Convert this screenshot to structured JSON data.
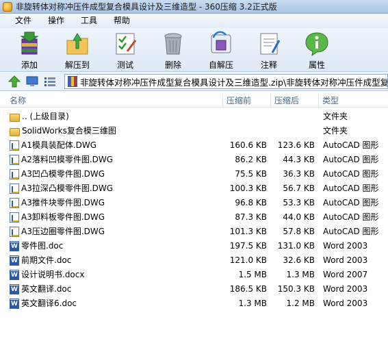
{
  "window": {
    "title": "非旋转体对称冲压件成型复合模具设计及三维造型 - 360压缩 3.2正式版"
  },
  "menu": [
    "文件",
    "操作",
    "工具",
    "帮助"
  ],
  "toolbar": [
    {
      "label": "添加",
      "icon": "add-archive-icon"
    },
    {
      "label": "解压到",
      "icon": "extract-to-icon"
    },
    {
      "label": "测试",
      "icon": "test-icon"
    },
    {
      "label": "删除",
      "icon": "delete-icon"
    },
    {
      "label": "自解压",
      "icon": "self-extract-icon"
    },
    {
      "label": "注释",
      "icon": "comment-icon"
    },
    {
      "label": "属性",
      "icon": "properties-icon"
    }
  ],
  "address": {
    "path": "非旋转体对称冲压件成型复合模具设计及三维造型.zip\\非旋转体对称冲压件成型复合模"
  },
  "columns": {
    "name": "名称",
    "size": "压缩前",
    "compressed": "压缩后",
    "type": "类型"
  },
  "files": [
    {
      "kind": "folder",
      "name": ".. (上级目录)",
      "size": "",
      "compressed": "",
      "type": "文件夹"
    },
    {
      "kind": "folder",
      "name": "SolidWorks复合模三维图",
      "size": "",
      "compressed": "",
      "type": "文件夹"
    },
    {
      "kind": "dwg",
      "name": "A1模具装配体.DWG",
      "size": "160.6 KB",
      "compressed": "123.6 KB",
      "type": "AutoCAD 图形"
    },
    {
      "kind": "dwg",
      "name": "A2落料凹模零件图.DWG",
      "size": "86.2 KB",
      "compressed": "44.3 KB",
      "type": "AutoCAD 图形"
    },
    {
      "kind": "dwg",
      "name": "A3凹凸模零件图.DWG",
      "size": "75.5 KB",
      "compressed": "36.3 KB",
      "type": "AutoCAD 图形"
    },
    {
      "kind": "dwg",
      "name": "A3拉深凸模零件图.DWG",
      "size": "100.3 KB",
      "compressed": "56.7 KB",
      "type": "AutoCAD 图形"
    },
    {
      "kind": "dwg",
      "name": "A3推件块零件图.DWG",
      "size": "96.8 KB",
      "compressed": "53.3 KB",
      "type": "AutoCAD 图形"
    },
    {
      "kind": "dwg",
      "name": "A3卸料板零件图.DWG",
      "size": "87.3 KB",
      "compressed": "44.0 KB",
      "type": "AutoCAD 图形"
    },
    {
      "kind": "dwg",
      "name": "A3压边圈零件图.DWG",
      "size": "101.3 KB",
      "compressed": "57.8 KB",
      "type": "AutoCAD 图形"
    },
    {
      "kind": "doc",
      "name": "零件图.doc",
      "size": "197.5 KB",
      "compressed": "131.0 KB",
      "type": "Word 2003"
    },
    {
      "kind": "doc",
      "name": "前期文件.doc",
      "size": "121.0 KB",
      "compressed": "32.6 KB",
      "type": "Word 2003"
    },
    {
      "kind": "doc",
      "name": "设计说明书.docx",
      "size": "1.5 MB",
      "compressed": "1.3 MB",
      "type": "Word 2007"
    },
    {
      "kind": "doc",
      "name": "英文翻译.doc",
      "size": "186.5 KB",
      "compressed": "150.3 KB",
      "type": "Word 2003"
    },
    {
      "kind": "doc",
      "name": "英文翻译6.doc",
      "size": "1.3 MB",
      "compressed": "1.2 MB",
      "type": "Word 2003"
    }
  ]
}
